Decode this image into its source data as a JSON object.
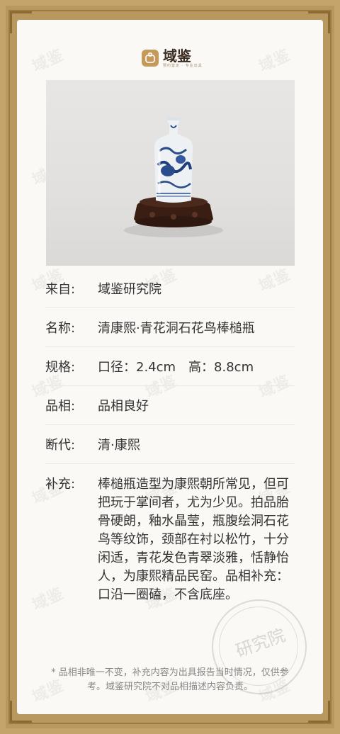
{
  "brand": {
    "name": "域鉴",
    "tagline": "预约鉴定 · 专业出具"
  },
  "watermark_text": "域鉴",
  "rows": [
    {
      "label": "来自:",
      "value": "域鉴研究院"
    },
    {
      "label": "名称:",
      "value": "清康熙·青花洞石花鸟棒槌瓶"
    },
    {
      "label": "规格:",
      "value": "口径：2.4cm　高：8.8cm"
    },
    {
      "label": "品相:",
      "value": "品相良好"
    },
    {
      "label": "断代:",
      "value": "清·康熙"
    },
    {
      "label": "补充:",
      "value": "棒槌瓶造型为康熙朝所常见，但可把玩于掌间者，尤为少见。拍品胎骨硬朗，釉水晶莹，瓶腹绘洞石花鸟等纹饰，颈部在衬以松竹，十分闲适，青花发色青翠淡雅，恬静怡人，为康熙精品民窑。品相补充：口沿一圈磕，不含底座。"
    }
  ],
  "note": "* 品相非唯一不变，补充内容为出具报告当时情况，仅供参考。域鉴研究院不对品相描述内容负责。",
  "seal_text": "研究院",
  "colors": {
    "frame": "#c4a46a",
    "card": "#fbf9f6",
    "text": "#333333",
    "accent": "#c49a5a"
  }
}
